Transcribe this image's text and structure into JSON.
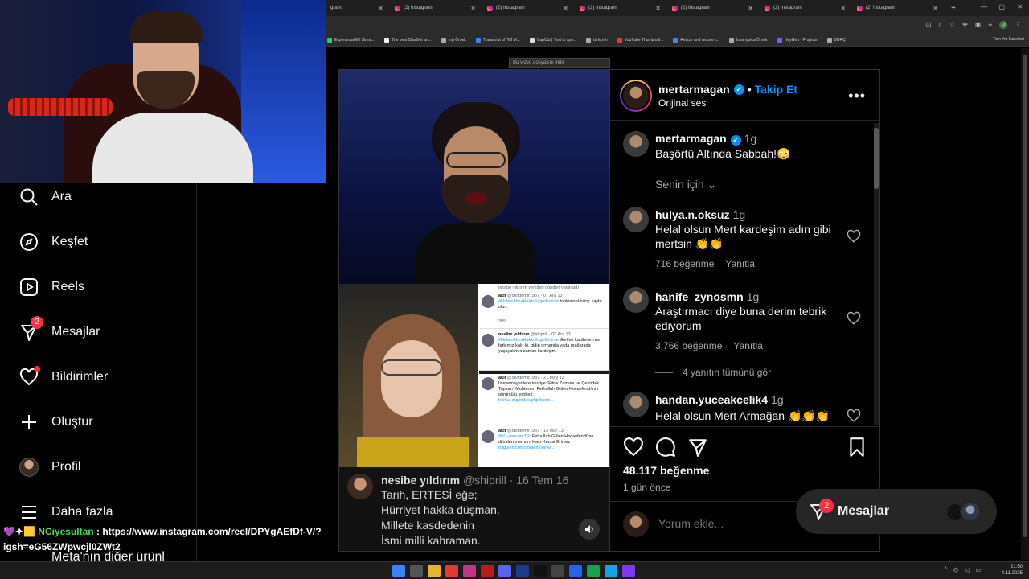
{
  "browser": {
    "tabs": [
      {
        "title": "gram"
      },
      {
        "title": "(2) Instagram"
      },
      {
        "title": "(2) Instagram"
      },
      {
        "title": "(2) Instagram"
      },
      {
        "title": "(2) Instagram"
      },
      {
        "title": "(2) Instagram"
      },
      {
        "title": "(2) Instagram"
      },
      {
        "title": "(2) Instagram"
      }
    ],
    "new_tab": "+",
    "bookmarks": [
      "Esperanza000 Strea...",
      "The best ChatBot an...",
      "İng Örnek",
      "Transcript of \"Mİ M...",
      "CapCut | Text to spe...",
      "türkçe h",
      "YouTube Thumbnail...",
      "Resize and reduce i...",
      "İspanyolca Örnek",
      "HeyGen - Projects",
      "BURÇ"
    ],
    "bookmarks_all": "Tüm Yer İşaretleri",
    "profile_initial": "U"
  },
  "nav": {
    "items": [
      {
        "label": "Ara",
        "icon": "search-icon"
      },
      {
        "label": "Keşfet",
        "icon": "explore-icon"
      },
      {
        "label": "Reels",
        "icon": "reels-icon"
      },
      {
        "label": "Mesajlar",
        "icon": "messenger-icon",
        "badge": "2"
      },
      {
        "label": "Bildirimler",
        "icon": "heart-icon"
      },
      {
        "label": "Oluştur",
        "icon": "plus-icon"
      },
      {
        "label": "Profil",
        "icon": "avatar"
      },
      {
        "label": "Daha fazla",
        "icon": "menu-icon"
      }
    ],
    "meta_more": "Meta'nın diğer ürünl"
  },
  "chat": {
    "emotes": "💜✦🟨",
    "user": "NCiyesultan",
    "message_1": ": https://www.instagram.com/reel/DPYgAEfDf-V/?",
    "message_2": "igsh=eG56ZWpwcjl0ZWt2"
  },
  "video": {
    "download_tooltip": "Bu video dosyasını indir",
    "tweets": [
      {
        "header": "nesibe yıldırım yeniden gönderi yayınladı",
        "user": "akif",
        "handle": "@okifdemir1987 · 07 Ara 13",
        "tag": "#HaberAlmaHakkıEngellenirse",
        "text": "toplumsal bilinç kaybı olur..",
        "stats": "395"
      },
      {
        "user": "nesibe yıldırım",
        "handle": "@shiprill · 07 Ara 13",
        "tag": "#HaberAlmaHakkıEngellenirse",
        "text": "ilkel bir kabileden ne farkımız kalır ki. gidip ormanda yada mağarada yaşayalım o zaman kardeşim."
      },
      {
        "user": "akif",
        "handle": "@okifdemir1987 · 21 May 13",
        "tag": "",
        "text": "İzleyemeyenlere tavsiye:\"Fitne Zamanı ve Çekirdek Toplum\" Muhterem Fethullah Gülen Hocaefendi'nin görüntülü sohbeti:",
        "link": "herkul.org/index.php/bamt..."
      },
      {
        "user": "akif",
        "handle": "@okifdemir1987 · 13 Mar 13",
        "tag": "#FGulencomTR",
        "text": ": Fethullah Gülen Hocaefendi'nin dilinden merhum Hacı Kemal Erimez",
        "link": "tr.fgulen.com/content/view/..."
      }
    ],
    "poster_name": "nesibe yıldırım",
    "poster_handle": "@shiprill",
    "poster_date": "· 16 Tem 16",
    "lines": [
      "Tarih, ERTESİ eğe;",
      "Hürriyet hakka düşman.",
      "Millete kasdedenin",
      "İsmi milli kahraman."
    ]
  },
  "post": {
    "author": "mertarmagan",
    "follow": "Takip Et",
    "audio": "Orijinal ses",
    "caption_user": "mertarmagan",
    "caption_time": "1g",
    "caption": "Başörtü Altında Sabbah!😳",
    "filter": "Senin için",
    "comments": [
      {
        "user": "hulya.n.oksuz",
        "time": "1g",
        "text": "Helal olsun Mert kardeşim adın gibi mertsin 👏👏",
        "likes": "716 beğenme",
        "reply": "Yanıtla"
      },
      {
        "user": "hanife_zynosmn",
        "time": "1g",
        "text": "Araştırmacı diye buna derim tebrik ediyorum",
        "likes": "3.766 beğenme",
        "reply": "Yanıtla"
      },
      {
        "user": "handan.yuceakcelik4",
        "time": "1g",
        "text": "Helal olsun Mert Armağan 👏👏👏",
        "likes": "",
        "reply": ""
      }
    ],
    "see_replies": "4 yanıtın tümünü gör",
    "like_count": "48.117 beğenme",
    "posted_ago": "1 gün önce",
    "comment_placeholder": "Yorum ekle..."
  },
  "messages_float": {
    "label": "Mesajlar",
    "badge": "2"
  },
  "taskbar": {
    "time": "21:50",
    "date": "4.11.2025"
  },
  "colors": {
    "accent": "#0095f6",
    "badge": "#ff3040",
    "bg": "#000000"
  }
}
